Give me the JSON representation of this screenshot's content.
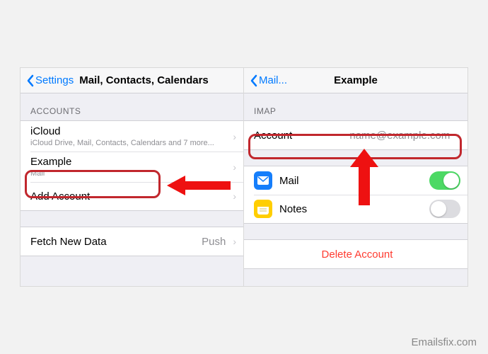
{
  "left": {
    "nav_back": "Settings",
    "nav_title": "Mail, Contacts, Calendars",
    "section_accounts": "ACCOUNTS",
    "rows": {
      "icloud": {
        "label": "iCloud",
        "sub": "iCloud Drive, Mail, Contacts, Calendars and 7 more..."
      },
      "example": {
        "label": "Example",
        "sub": "Mail"
      },
      "add": {
        "label": "Add Account"
      }
    },
    "fetch": {
      "label": "Fetch New Data",
      "value": "Push"
    }
  },
  "right": {
    "nav_back": "Mail...",
    "nav_title": "Example",
    "section_imap": "IMAP",
    "account": {
      "label": "Account",
      "value": "name@example.com"
    },
    "mail": {
      "label": "Mail",
      "on": true
    },
    "notes": {
      "label": "Notes",
      "on": false
    },
    "delete": "Delete Account"
  },
  "watermark": "Emailsfix.com"
}
